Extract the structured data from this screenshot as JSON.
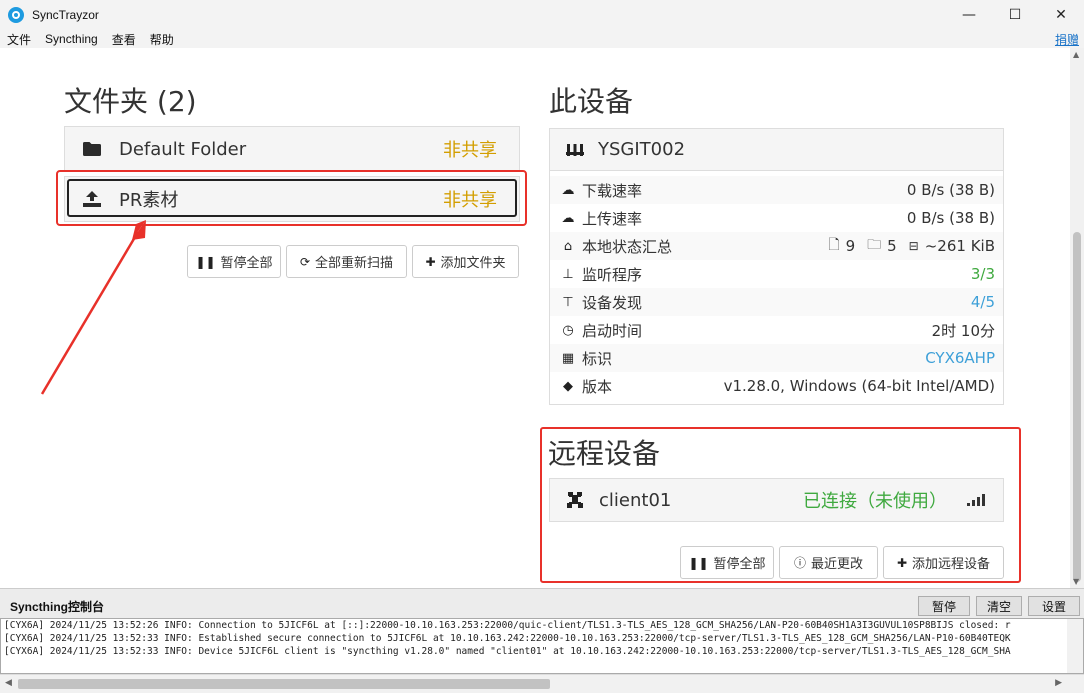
{
  "window": {
    "title": "SyncTrayzor",
    "minimize": "—",
    "maximize": "☐",
    "close": "✕"
  },
  "menu": {
    "items": [
      "文件",
      "Syncthing",
      "查看",
      "帮助"
    ],
    "donate": "捐赠"
  },
  "folders": {
    "title": "文件夹 (2)",
    "items": [
      {
        "name": "Default Folder",
        "state": "非共享",
        "icon": "folder-icon"
      },
      {
        "name": "PR素材",
        "state": "非共享",
        "icon": "upload-icon"
      }
    ],
    "buttons": {
      "pause_all": "暂停全部",
      "rescan_all": "全部重新扫描",
      "add_folder": "添加文件夹"
    }
  },
  "this_device": {
    "title": "此设备",
    "name": "YSGIT002",
    "rows": [
      {
        "label": "下载速率",
        "value": "0 B/s (38 B)",
        "icon": "cloud-download-icon"
      },
      {
        "label": "上传速率",
        "value": "0 B/s (38 B)",
        "icon": "cloud-upload-icon"
      },
      {
        "label": "本地状态汇总",
        "files": "9",
        "dirs": "5",
        "size": "~261 KiB",
        "icon": "home-icon"
      },
      {
        "label": "监听程序",
        "value": "3/3",
        "icon": "sitemap-icon"
      },
      {
        "label": "设备发现",
        "value": "4/5",
        "icon": "signpost-icon"
      },
      {
        "label": "启动时间",
        "value": "2时 10分",
        "icon": "clock-icon"
      },
      {
        "label": "标识",
        "value": "CYX6AHP",
        "icon": "qrcode-icon"
      },
      {
        "label": "版本",
        "value": "v1.28.0, Windows (64-bit Intel/AMD)",
        "icon": "tag-icon"
      }
    ]
  },
  "remote_devices": {
    "title": "远程设备",
    "items": [
      {
        "name": "client01",
        "status": "已连接（未使用）"
      }
    ],
    "buttons": {
      "pause_all": "暂停全部",
      "recent_changes": "最近更改",
      "add_remote": "添加远程设备"
    }
  },
  "console": {
    "title": "Syncthing控制台",
    "pause": "暂停",
    "clear": "清空",
    "settings": "设置",
    "lines": [
      "[CYX6A] 2024/11/25 13:52:26 INFO: Connection to 5JICF6L at [::]:22000-10.10.163.253:22000/quic-client/TLS1.3-TLS_AES_128_GCM_SHA256/LAN-P20-60B40SH1A3I3GUVUL10SP8BIJS closed: r",
      "[CYX6A] 2024/11/25 13:52:33 INFO: Established secure connection to 5JICF6L at 10.10.163.242:22000-10.10.163.253:22000/tcp-server/TLS1.3-TLS_AES_128_GCM_SHA256/LAN-P10-60B40TEQK",
      "[CYX6A] 2024/11/25 13:52:33 INFO: Device 5JICF6L client is \"syncthing v1.28.0\" named \"client01\" at 10.10.163.242:22000-10.10.163.253:22000/tcp-server/TLS1.3-TLS_AES_128_GCM_SHA"
    ]
  },
  "colors": {
    "accent_red": "#e8312a",
    "unshared_orange": "#d39e00",
    "green": "#3fa93f",
    "blue": "#3ea0d8"
  }
}
